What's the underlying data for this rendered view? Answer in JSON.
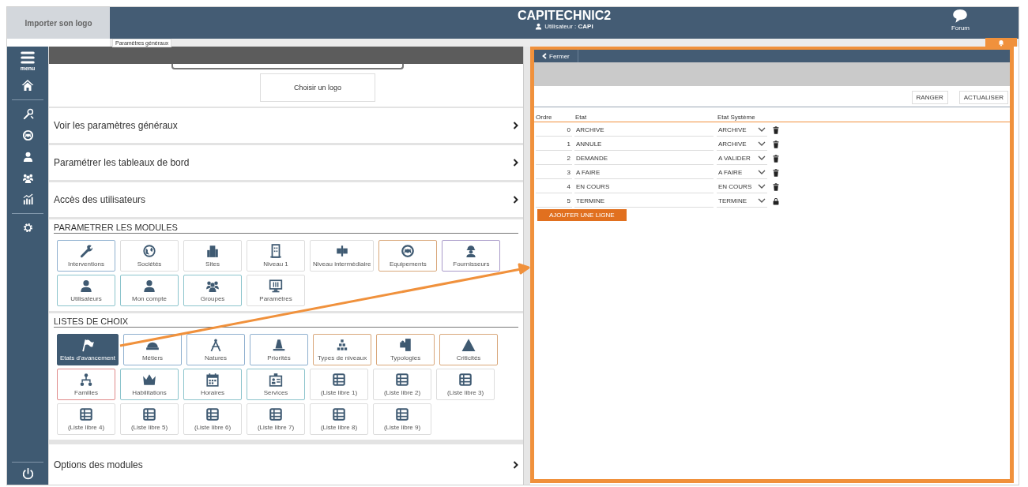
{
  "header": {
    "logo_placeholder": "Importer son logo",
    "title": "CAPITECHNIC2",
    "user": "Utilisateur : **CAPI**",
    "forum": "Forum"
  },
  "breadcrumb_tab": "Paramètres généraux",
  "sidebar": {
    "menu_label": "menu"
  },
  "logo_button": "Choisir un logo",
  "links": [
    "Voir les paramètres généraux",
    "Paramétrer les tableaux de bord",
    "Accès des utilisateurs"
  ],
  "sections": [
    {
      "title": "PARAMETRER LES MODULES",
      "tiles": [
        {
          "label": "Interventions",
          "color": "#8fb0cf",
          "selected": false
        },
        {
          "label": "Sociétés",
          "color": "#dddddd",
          "selected": false
        },
        {
          "label": "Sites",
          "color": "#dddddd",
          "selected": false
        },
        {
          "label": "Niveau 1",
          "color": "#dddddd",
          "selected": false
        },
        {
          "label": "Niveau intermédiaire",
          "color": "#dddddd",
          "selected": false
        },
        {
          "label": "Equipements",
          "color": "#d9a77a",
          "selected": false
        },
        {
          "label": "Fournisseurs",
          "color": "#a99bc9",
          "selected": false
        },
        {
          "label": "Utilisateurs",
          "color": "#8cc4cc",
          "selected": false
        },
        {
          "label": "Mon compte",
          "color": "#8cc4cc",
          "selected": false
        },
        {
          "label": "Groupes",
          "color": "#8cc4cc",
          "selected": false
        },
        {
          "label": "Paramètres",
          "color": "#dddddd",
          "selected": false
        }
      ]
    },
    {
      "title": "LISTES DE CHOIX",
      "tiles": [
        {
          "label": "Etats d'avancement",
          "color": "#3f5a72",
          "selected": true
        },
        {
          "label": "Métiers",
          "color": "#8fb0cf",
          "selected": false
        },
        {
          "label": "Natures",
          "color": "#8fb0cf",
          "selected": false
        },
        {
          "label": "Priorités",
          "color": "#8fb0cf",
          "selected": false
        },
        {
          "label": "Types de niveaux",
          "color": "#d9a77a",
          "selected": false
        },
        {
          "label": "Typologies",
          "color": "#d9a77a",
          "selected": false
        },
        {
          "label": "Criticités",
          "color": "#d9a77a",
          "selected": false
        },
        {
          "label": "Familles",
          "color": "#e08a8a",
          "selected": false
        },
        {
          "label": "Habilitations",
          "color": "#8cc4cc",
          "selected": false
        },
        {
          "label": "Horaires",
          "color": "#8cc4cc",
          "selected": false
        },
        {
          "label": "Services",
          "color": "#8cc4cc",
          "selected": false
        },
        {
          "label": "(Liste libre 1)",
          "color": "#dddddd",
          "selected": false
        },
        {
          "label": "(Liste libre 2)",
          "color": "#dddddd",
          "selected": false
        },
        {
          "label": "(Liste libre 3)",
          "color": "#dddddd",
          "selected": false
        },
        {
          "label": "(Liste libre 4)",
          "color": "#dddddd",
          "selected": false
        },
        {
          "label": "(Liste libre 5)",
          "color": "#dddddd",
          "selected": false
        },
        {
          "label": "(Liste libre 6)",
          "color": "#dddddd",
          "selected": false
        },
        {
          "label": "(Liste libre 7)",
          "color": "#dddddd",
          "selected": false
        },
        {
          "label": "(Liste libre 8)",
          "color": "#dddddd",
          "selected": false
        },
        {
          "label": "(Liste libre 9)",
          "color": "#dddddd",
          "selected": false
        }
      ]
    }
  ],
  "footer_link": "Options des modules",
  "panel": {
    "close": "Fermer",
    "actions": [
      "RANGER",
      "ACTUALISER"
    ],
    "columns": [
      "Ordre",
      "Etat",
      "Etat Système"
    ],
    "rows": [
      {
        "order": "0",
        "state": "ARCHIVE",
        "system_state": "ARCHIVE",
        "deletable": true
      },
      {
        "order": "1",
        "state": "ANNULE",
        "system_state": "ARCHIVE",
        "deletable": true
      },
      {
        "order": "2",
        "state": "DEMANDE",
        "system_state": "A VALIDER",
        "deletable": true
      },
      {
        "order": "3",
        "state": "A FAIRE",
        "system_state": "A FAIRE",
        "deletable": true
      },
      {
        "order": "4",
        "state": "EN COURS",
        "system_state": "EN COURS",
        "deletable": true
      },
      {
        "order": "5",
        "state": "TERMINE",
        "system_state": "TERMINE",
        "deletable": false
      }
    ],
    "add_button": "AJOUTER UNE LIGNE"
  }
}
